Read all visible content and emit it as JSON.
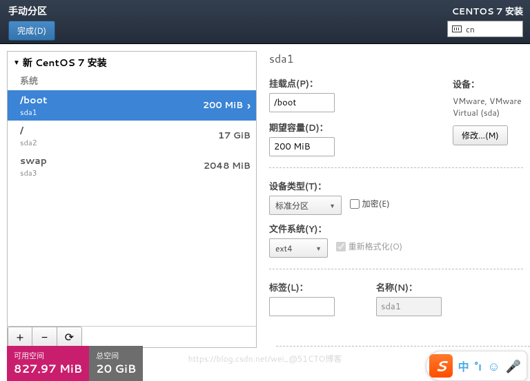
{
  "header": {
    "page_title": "手动分区",
    "done_button": "完成(D)",
    "installer_title": "CENTOS 7 安装",
    "keyboard_layout": "cn"
  },
  "tree": {
    "title": "新 CentOS 7 安装",
    "section": "系统",
    "items": [
      {
        "mount": "/boot",
        "dev": "sda1",
        "size": "200 MiB",
        "selected": true
      },
      {
        "mount": "/",
        "dev": "sda2",
        "size": "17 GiB",
        "selected": false
      },
      {
        "mount": "swap",
        "dev": "sda3",
        "size": "2048 MiB",
        "selected": false
      }
    ],
    "toolbar": {
      "add": "+",
      "remove": "−",
      "refresh": "⟳"
    }
  },
  "details": {
    "heading": "sda1",
    "mount_label": "挂载点(P)：",
    "mount_value": "/boot",
    "capacity_label": "期望容量(D)：",
    "capacity_value": "200 MiB",
    "devices_label": "设备：",
    "devices_text": "VMware, VMware Virtual (sda)",
    "modify_button": "修改...(M)",
    "device_type_label": "设备类型(T)：",
    "device_type_value": "标准分区",
    "encrypt_label": "加密(E)",
    "filesystem_label": "文件系统(Y)：",
    "filesystem_value": "ext4",
    "reformat_label": "重新格式化(O)",
    "reformat_checked": true,
    "label_label": "标签(L)：",
    "label_value": "",
    "name_label": "名称(N)：",
    "name_value": "sda1"
  },
  "footer": {
    "avail_label": "可用空间",
    "avail_value": "827.97 MiB",
    "total_label": "总空间",
    "total_value": "20 GiB"
  },
  "ime": {
    "logo": "S",
    "mode": "中",
    "punct": "°ı",
    "face": "☺",
    "mic": "🎤"
  },
  "watermark": "https://blog.csdn.net/wei_@51CTO博客"
}
